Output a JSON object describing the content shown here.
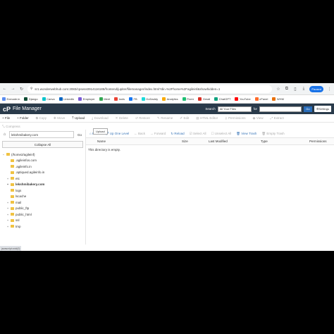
{
  "browser": {
    "url": "sr1.wonderwebhub.com:2083/cpsess0914116185/frontend/jupiter/filemanager/index.html?dir=%2Fhome%2Fagileinf&showhidden=1",
    "profile_label": "Paused"
  },
  "bookmarks": [
    {
      "label": "Exmade.in",
      "color": "#5b8def"
    },
    {
      "label": "Django",
      "color": "#0c4b33"
    },
    {
      "label": "Canva",
      "color": "#00c4cc"
    },
    {
      "label": "LinkedIn",
      "color": "#0a66c2"
    },
    {
      "label": "Employer",
      "color": "#7a5bd6"
    },
    {
      "label": "Meet",
      "color": "#34a853"
    },
    {
      "label": "tools",
      "color": "#ea4335"
    },
    {
      "label": "FB",
      "color": "#1877f2"
    },
    {
      "label": "GoDaddy",
      "color": "#1bdbdb"
    },
    {
      "label": "Analytics",
      "color": "#f9ab00"
    },
    {
      "label": "Fiverr",
      "color": "#1dbf73"
    },
    {
      "label": "Gmail",
      "color": "#d93025"
    },
    {
      "label": "ChatGPT",
      "color": "#10a37f"
    },
    {
      "label": "YouTube",
      "color": "#ff0000"
    },
    {
      "label": "cPanel",
      "color": "#ff6c2c"
    },
    {
      "label": "WHM",
      "color": "#e8710a"
    }
  ],
  "header": {
    "logo": "cP",
    "title": "File Manager",
    "search_label": "Search",
    "search_scope": "All Your Files",
    "for_label": "for",
    "go_label": "Go",
    "settings_label": "Settings"
  },
  "toolbar": {
    "file": "+ File",
    "folder": "+ Folder",
    "copy": "Copy",
    "move": "Move",
    "upload": "Upload",
    "download": "Download",
    "delete": "Delete",
    "restore": "Restore",
    "rename": "Rename",
    "edit": "Edit",
    "html_editor": "HTML Editor",
    "permissions": "Permissions",
    "view": "View",
    "extract": "Extract",
    "compress": "Compress",
    "tooltip": "Upload"
  },
  "sidebar": {
    "dir_value": "lekshmibakery.com",
    "go_label": "Go",
    "collapse_label": "Collapse All",
    "tree": [
      {
        "label": "(/home2/agileinf)",
        "level": 0,
        "exp": "−",
        "bold": false
      },
      {
        "label": ".agileinfos.com",
        "level": 1,
        "exp": "",
        "bold": false
      },
      {
        "label": ".agileinfo.in",
        "level": 1,
        "exp": "",
        "bold": false
      },
      {
        "label": ".aptiqued.agileinfo.in",
        "level": 1,
        "exp": "",
        "bold": false
      },
      {
        "label": "etc",
        "level": 1,
        "exp": "+",
        "bold": false
      },
      {
        "label": "lekshmibakery.com",
        "level": 1,
        "exp": "+",
        "bold": true
      },
      {
        "label": "logs",
        "level": 1,
        "exp": "",
        "bold": false
      },
      {
        "label": "lscache",
        "level": 1,
        "exp": "",
        "bold": false
      },
      {
        "label": "mail",
        "level": 1,
        "exp": "+",
        "bold": false
      },
      {
        "label": "public_ftp",
        "level": 1,
        "exp": "+",
        "bold": false
      },
      {
        "label": "public_html",
        "level": 1,
        "exp": "+",
        "bold": false
      },
      {
        "label": "ssl",
        "level": 1,
        "exp": "+",
        "bold": false
      },
      {
        "label": "tmp",
        "level": 1,
        "exp": "+",
        "bold": false
      }
    ]
  },
  "content_toolbar": {
    "home": "Home",
    "up_one_level": "Up One Level",
    "back": "Back",
    "forward": "Forward",
    "reload": "Reload",
    "select_all": "Select All",
    "unselect_all": "Unselect All",
    "view_trash": "View Trash",
    "empty_trash": "Empty Trash"
  },
  "table": {
    "columns": [
      "Name",
      "Size",
      "Last Modified",
      "Type",
      "Permissions"
    ],
    "empty_message": "This directory is empty."
  },
  "status_bar": "javascript:void(0)"
}
